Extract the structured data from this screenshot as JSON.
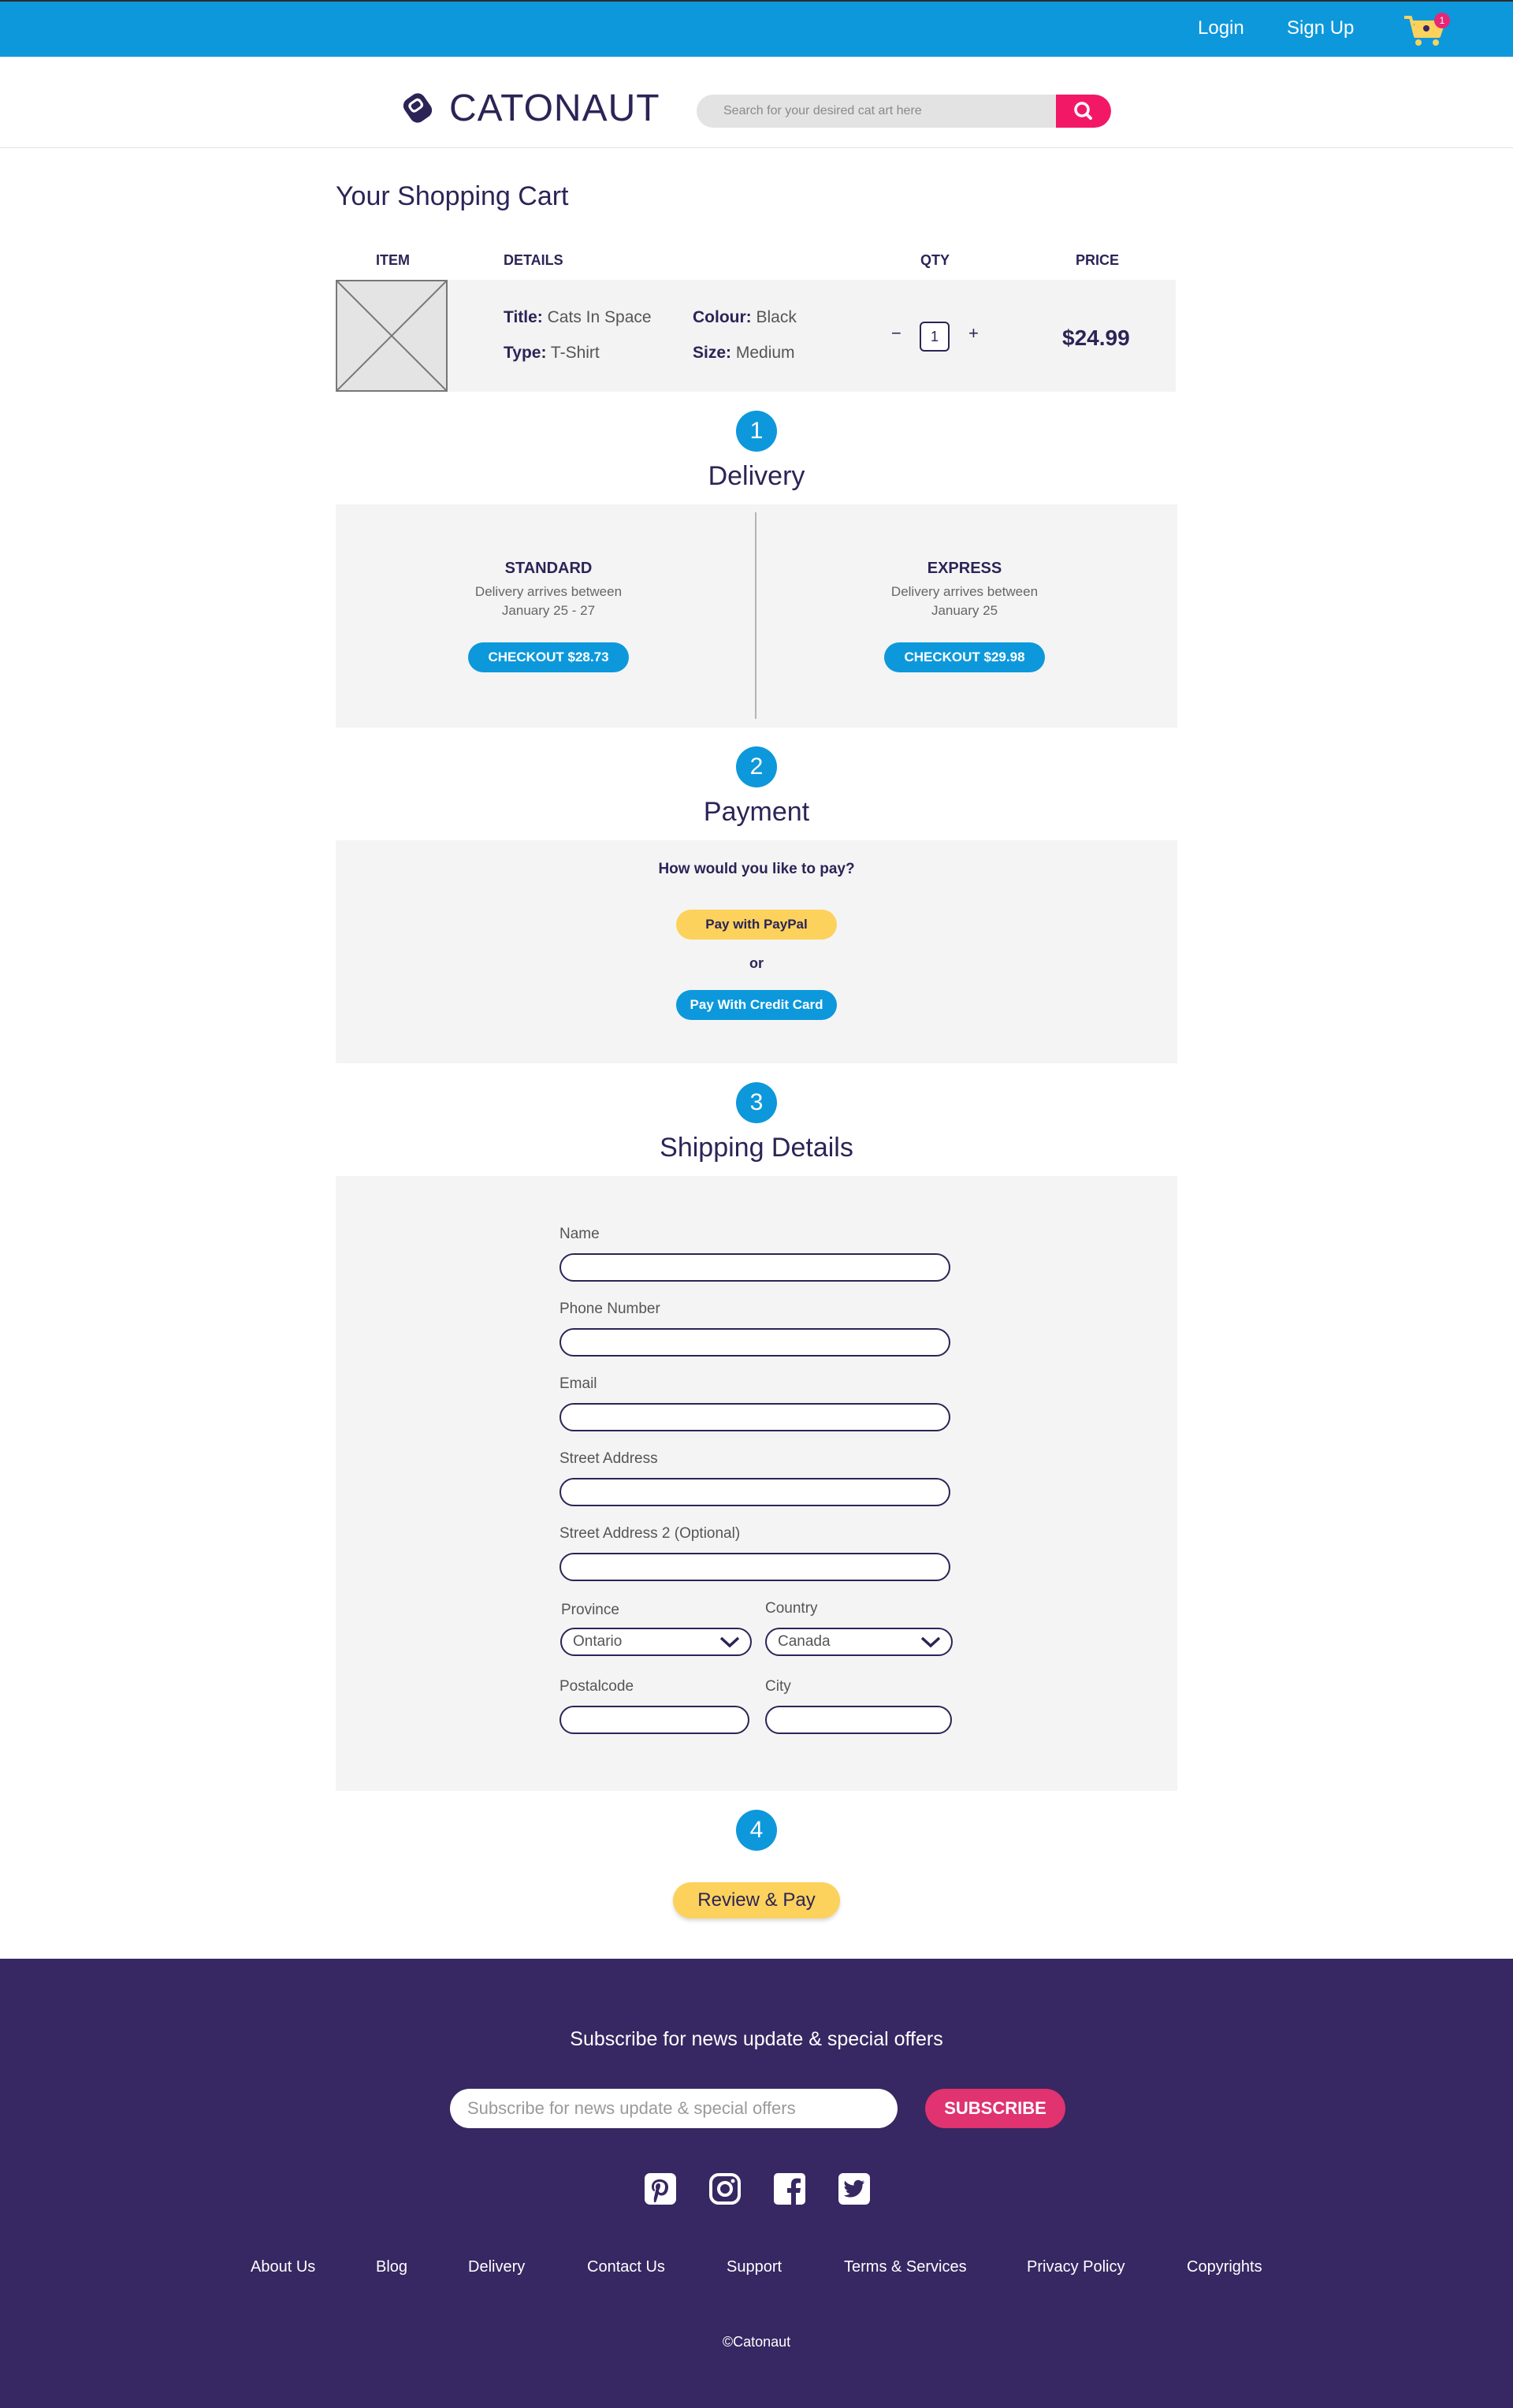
{
  "nav": {
    "login": "Login",
    "signup": "Sign Up",
    "cart_count": "1"
  },
  "brand": {
    "name": "CATONAUT"
  },
  "search": {
    "placeholder": "Search for your desired cat art here"
  },
  "cart": {
    "title": "Your Shopping Cart",
    "headers": {
      "item": "ITEM",
      "details": "DETAILS",
      "qty": "QTY",
      "price": "PRICE"
    },
    "item": {
      "title_label": "Title:",
      "title": "Cats In Space",
      "colour_label": "Colour:",
      "colour": "Black",
      "type_label": "Type:",
      "type": "T-Shirt",
      "size_label": "Size:",
      "size": "Medium",
      "qty_minus": "−",
      "qty": "1",
      "qty_plus": "+",
      "price": "$24.99"
    }
  },
  "delivery": {
    "step": "1",
    "title": "Delivery",
    "standard": {
      "name": "STANDARD",
      "desc1": "Delivery arrives between",
      "desc2": "January 25 - 27",
      "button": "CHECKOUT $28.73"
    },
    "express": {
      "name": "EXPRESS",
      "desc1": "Delivery arrives between",
      "desc2": "January 25",
      "button": "CHECKOUT $29.98"
    }
  },
  "payment": {
    "step": "2",
    "title": "Payment",
    "question": "How would you like to pay?",
    "paypal": "Pay with PayPal",
    "or": "or",
    "credit_card": "Pay With Credit Card"
  },
  "shipping": {
    "step": "3",
    "title": "Shipping Details",
    "name_label": "Name",
    "phone_label": "Phone Number",
    "email_label": "Email",
    "street_label": "Street Address",
    "street2_label": "Street Address 2 (Optional)",
    "province_label": "Province",
    "province_value": "Ontario",
    "country_label": "Country",
    "country_value": "Canada",
    "postal_label": "Postalcode",
    "city_label": "City"
  },
  "review": {
    "step": "4",
    "button": "Review & Pay"
  },
  "footer": {
    "subscribe_title": "Subscribe for news update & special offers",
    "subscribe_placeholder": "Subscribe for news update & special offers",
    "subscribe_button": "SUBSCRIBE",
    "social_icons": [
      "pinterest-icon",
      "instagram-icon",
      "facebook-icon",
      "twitter-icon"
    ],
    "links": [
      "About Us",
      "Blog",
      "Delivery",
      "Contact Us",
      "Support",
      "Terms & Services",
      "Privacy Policy",
      "Copyrights"
    ],
    "copyright": "©Catonaut"
  },
  "colors": {
    "primary_blue": "#0d98dc",
    "navy": "#2c2456",
    "accent_pink": "#f31866",
    "yellow": "#fcd25c",
    "footer_bg": "#372762"
  }
}
